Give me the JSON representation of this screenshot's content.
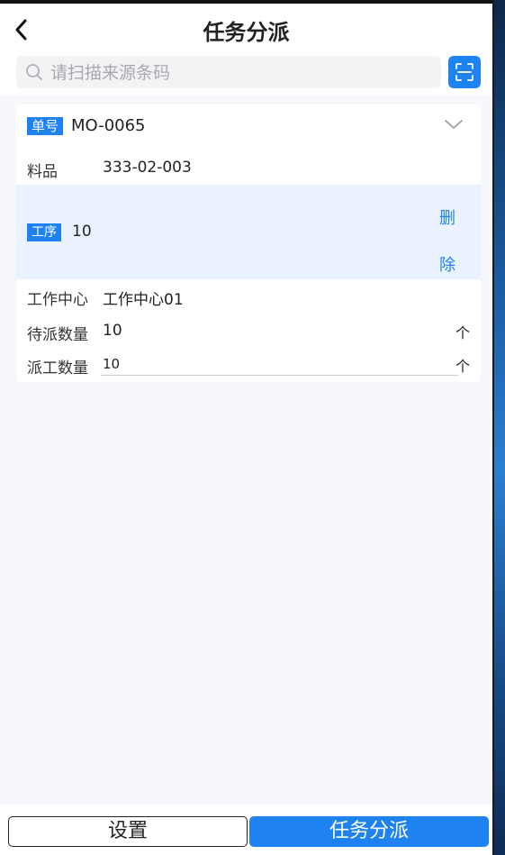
{
  "header": {
    "title": "任务分派"
  },
  "search": {
    "placeholder": "请扫描来源条码"
  },
  "card": {
    "order_tag": "单号",
    "order_no": "MO-0065",
    "material_label": "料品",
    "material_value": "333-02-003",
    "operation_tag": "工序",
    "operation_value": "10",
    "delete_label": "删除",
    "work_center_label": "工作中心",
    "work_center_value": "工作中心01",
    "pending_qty_label": "待派数量",
    "pending_qty_value": "10",
    "pending_unit": "个",
    "dispatch_qty_label": "派工数量",
    "dispatch_qty_value": "10",
    "dispatch_unit": "个"
  },
  "footer": {
    "settings_label": "设置",
    "dispatch_label": "任务分派"
  },
  "colors": {
    "accent": "#1e82f0",
    "band": "#e9f2fe"
  },
  "icons": {
    "back": "chevron-left-icon",
    "search": "search-icon",
    "scan": "scan-icon",
    "collapse": "chevron-down-icon"
  }
}
